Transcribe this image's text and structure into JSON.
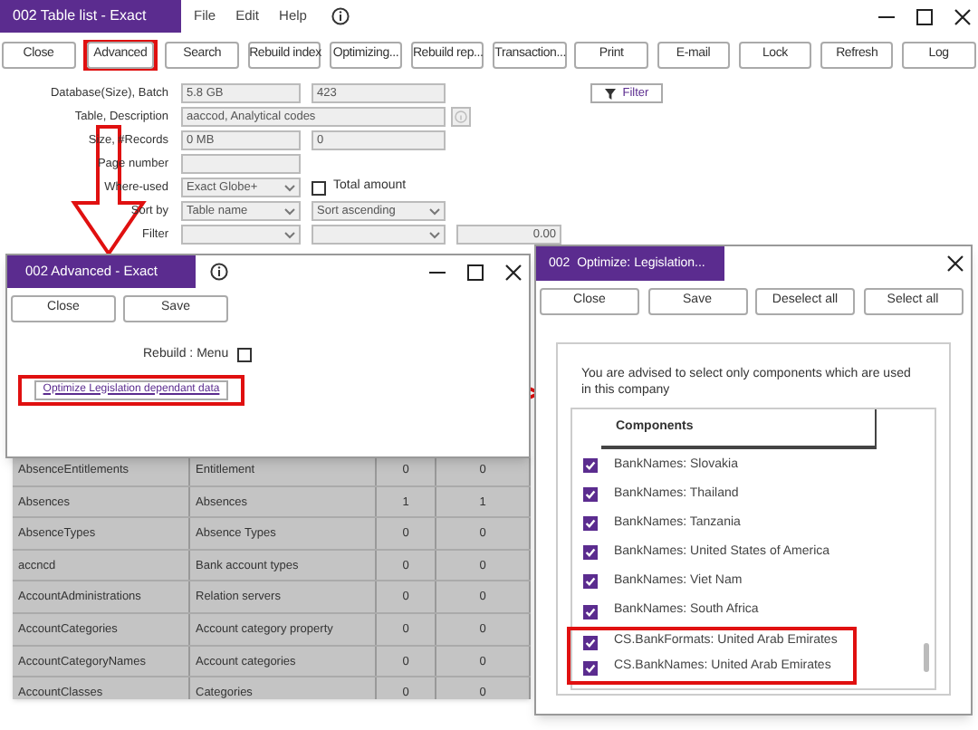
{
  "main_window": {
    "title": "002 Table list - Exact",
    "menu": [
      "File",
      "Edit",
      "Help"
    ]
  },
  "toolbar": [
    {
      "label": "Close",
      "highlighted": false
    },
    {
      "label": "Advanced",
      "highlighted": true
    },
    {
      "label": "Search",
      "highlighted": false
    },
    {
      "label": "Rebuild index",
      "highlighted": false
    },
    {
      "label": "Optimizing...",
      "highlighted": false
    },
    {
      "label": "Rebuild rep...",
      "highlighted": false
    },
    {
      "label": "Transaction...",
      "highlighted": false
    },
    {
      "label": "Print",
      "highlighted": false
    },
    {
      "label": "E-mail",
      "highlighted": false
    },
    {
      "label": "Lock",
      "highlighted": false
    },
    {
      "label": "Refresh",
      "highlighted": false
    },
    {
      "label": "Log",
      "highlighted": false
    }
  ],
  "filter_button": "Filter",
  "form": [
    {
      "kind": "pair",
      "label": "Database(Size), Batch",
      "fields": [
        "5.8 GB",
        "423"
      ]
    },
    {
      "kind": "wide",
      "label": "Table, Description",
      "fields": [
        "aaccod, Analytical codes"
      ]
    },
    {
      "kind": "pair",
      "label": "Size, #Records",
      "fields": [
        "0 MB",
        "0"
      ]
    },
    {
      "kind": "single",
      "label": "Page number"
    },
    {
      "kind": "select_check",
      "label": "Where-used",
      "selects": [
        "Exact Globe+"
      ],
      "check_label": "Total amount",
      "checked": false
    },
    {
      "kind": "select_pair",
      "label": "Sort by",
      "selects": [
        "Table name",
        "Sort ascending"
      ]
    },
    {
      "kind": "filter",
      "label": "Filter",
      "amount": "0.00"
    }
  ],
  "table": {
    "rows": [
      {
        "column_1": "AbsenceEntitlements",
        "column_2": "Entitlement",
        "column_3": "0",
        "column_4": "0"
      },
      {
        "column_1": "Absences",
        "column_2": "Absences",
        "column_3": "1",
        "column_4": "1"
      },
      {
        "column_1": "AbsenceTypes",
        "column_2": "Absence Types",
        "column_3": "0",
        "column_4": "0"
      },
      {
        "column_1": "accncd",
        "column_2": "Bank account types",
        "column_3": "0",
        "column_4": "0"
      },
      {
        "column_1": "AccountAdministrations",
        "column_2": "Relation servers",
        "column_3": "0",
        "column_4": "0"
      },
      {
        "column_1": "AccountCategories",
        "column_2": "Account category property",
        "column_3": "0",
        "column_4": "0"
      },
      {
        "column_1": "AccountCategoryNames",
        "column_2": "Account categories",
        "column_3": "0",
        "column_4": "0"
      },
      {
        "column_1": "AccountClasses",
        "column_2": "Categories",
        "column_3": "0",
        "column_4": "0"
      }
    ]
  },
  "advanced_dialog": {
    "title": "002 Advanced - Exact",
    "buttons": [
      "Close",
      "Save"
    ],
    "rebuild_label": "Rebuild : Menu",
    "rebuild_checked": false,
    "optimize_button": {
      "label": "Optimize Legislation dependant data",
      "highlighted": true
    }
  },
  "optimize_dialog": {
    "title": "002  Optimize: Legislation...",
    "buttons": [
      "Close",
      "Save",
      "Deselect all",
      "Select all"
    ],
    "advice": "You are advised to select only components which are used in this company",
    "column_header": "Components",
    "items": [
      {
        "label": "BankNames: Slovakia",
        "checked": true,
        "highlighted": false
      },
      {
        "label": "BankNames: Thailand",
        "checked": true,
        "highlighted": false
      },
      {
        "label": "BankNames: Tanzania",
        "checked": true,
        "highlighted": false
      },
      {
        "label": "BankNames: United States of America",
        "checked": true,
        "highlighted": false
      },
      {
        "label": "BankNames: Viet Nam",
        "checked": true,
        "highlighted": false
      },
      {
        "label": "BankNames: South Africa",
        "checked": true,
        "highlighted": false
      },
      {
        "label": "CS.BankFormats: United Arab Emirates",
        "checked": true,
        "highlighted": true
      },
      {
        "label": "CS.BankNames: United Arab Emirates",
        "checked": true,
        "highlighted": true
      }
    ]
  }
}
